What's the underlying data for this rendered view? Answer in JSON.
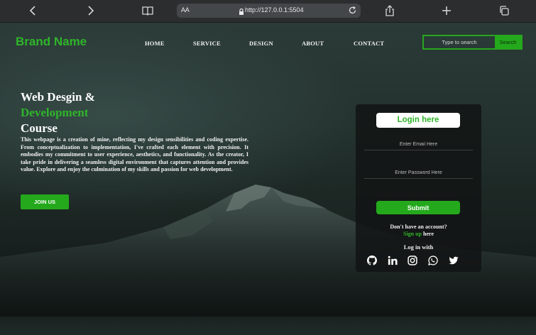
{
  "browser": {
    "text_size_label": "AA",
    "url": "http://127.0.0.1:5504"
  },
  "site": {
    "brand": "Brand Name",
    "nav": [
      "HOME",
      "SERVICE",
      "DESIGN",
      "ABOUT",
      "CONTACT"
    ],
    "search": {
      "placeholder": "Type to search",
      "button": "Search"
    }
  },
  "hero": {
    "title_line1": "Web Desgin &",
    "title_line2": "Development",
    "title_line3": "Course",
    "paragraph": "This webpage is a creation of mine, reflecting my design sensibilities and coding expertise. From conceptualization to implementation, I've crafted each element with precision. It embodies my commitment to user experience, aesthetics, and functionality. As the creator, I take pride in delivering a seamless digital environment that captures attention and provides value. Explore and enjoy the culmination of my skills and passion for web development.",
    "cta": "JOIN US"
  },
  "login": {
    "heading": "Login here",
    "email_placeholder": "Enter Email Here",
    "password_placeholder": "Enter Password Here",
    "submit": "Submit",
    "no_account": "Don't have an account?",
    "signup_link": "Sign up",
    "signup_suffix": " here",
    "login_with": "Log in with",
    "social_icons": [
      "github-icon",
      "linkedin-icon",
      "instagram-icon",
      "whatsapp-icon",
      "twitter-icon"
    ]
  },
  "colors": {
    "accent_green": "#2fb52a",
    "button_green": "#24a91c"
  }
}
